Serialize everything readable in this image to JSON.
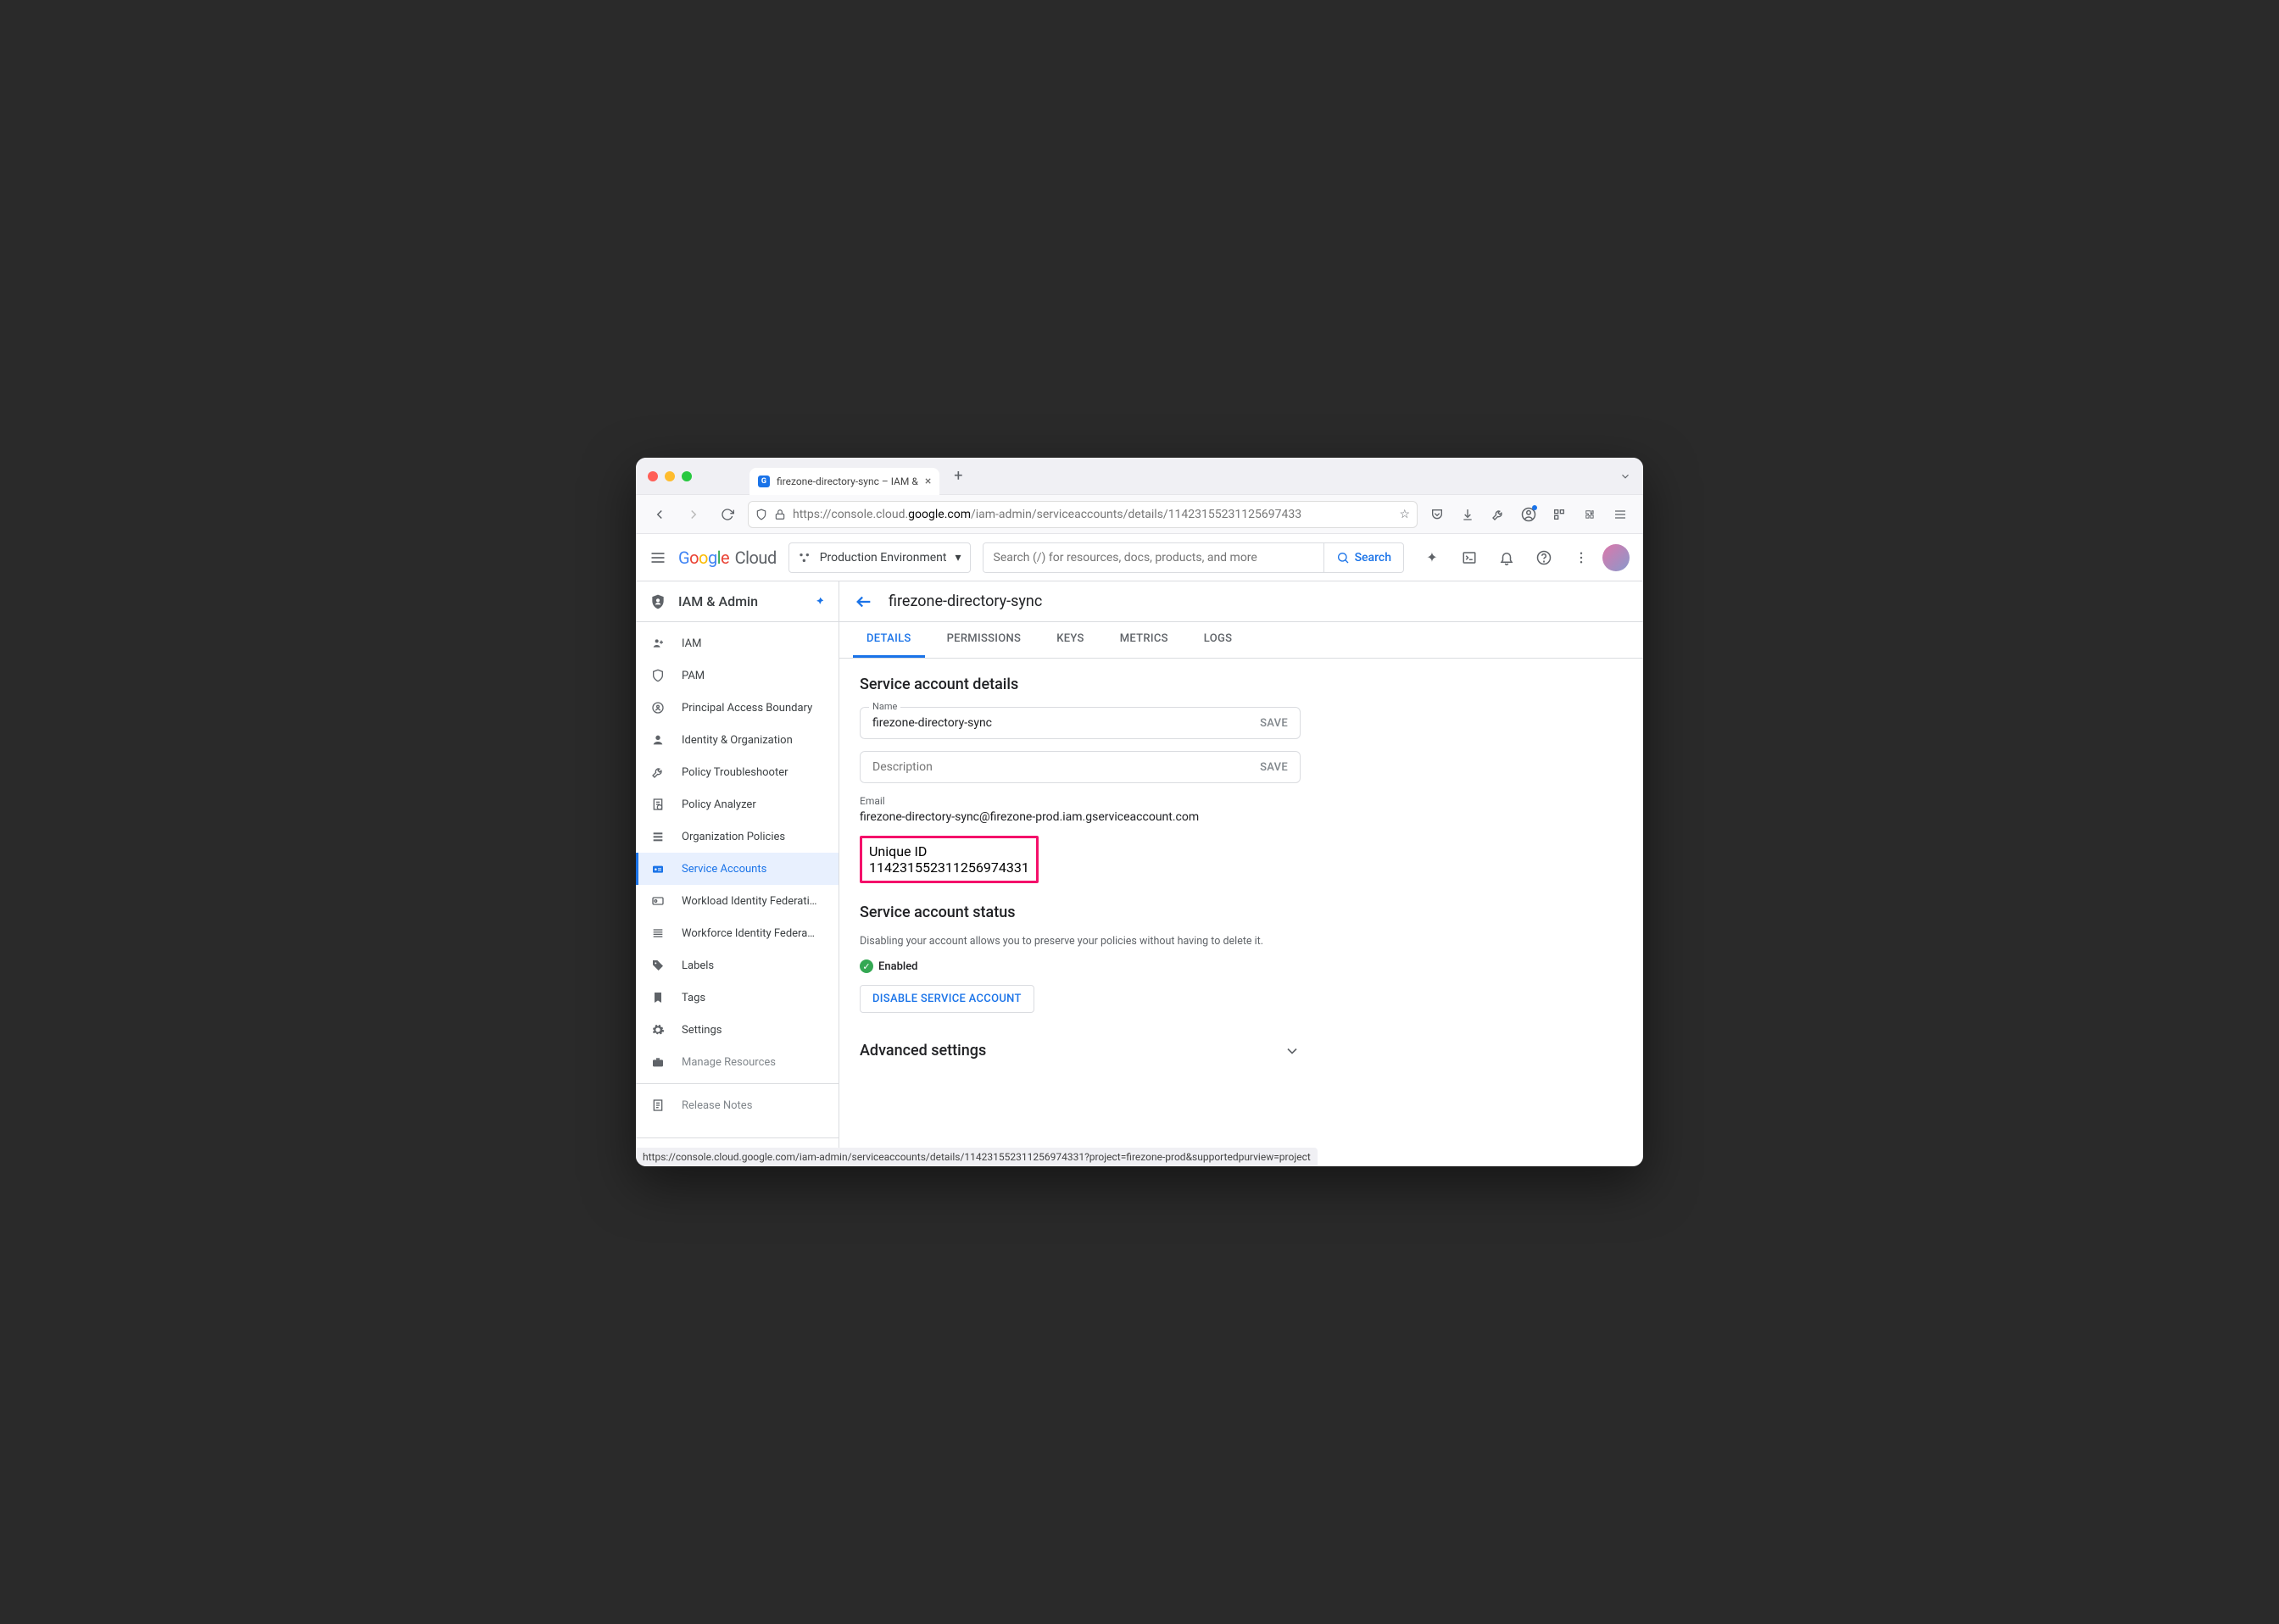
{
  "browser": {
    "tab_title": "firezone-directory-sync – IAM &",
    "url_prefix": "https://console.cloud.",
    "url_host_bold": "google.com",
    "url_path": "/iam-admin/serviceaccounts/details/11423155231125697433",
    "status_bar": "https://console.cloud.google.com/iam-admin/serviceaccounts/details/114231552311256974331?project=firezone-prod&supportedpurview=project"
  },
  "gcp": {
    "product_name": "Cloud",
    "project": "Production Environment",
    "search_placeholder": "Search (/) for resources, docs, products, and more",
    "search_button": "Search"
  },
  "sidebar": {
    "section_title": "IAM & Admin",
    "items": [
      {
        "label": "IAM"
      },
      {
        "label": "PAM"
      },
      {
        "label": "Principal Access Boundary"
      },
      {
        "label": "Identity & Organization"
      },
      {
        "label": "Policy Troubleshooter"
      },
      {
        "label": "Policy Analyzer"
      },
      {
        "label": "Organization Policies"
      },
      {
        "label": "Service Accounts"
      },
      {
        "label": "Workload Identity Federati…"
      },
      {
        "label": "Workforce Identity Federa…"
      },
      {
        "label": "Labels"
      },
      {
        "label": "Tags"
      },
      {
        "label": "Settings"
      },
      {
        "label": "Manage Resources"
      },
      {
        "label": "Release Notes"
      }
    ]
  },
  "main": {
    "title": "firezone-directory-sync",
    "tabs": [
      "DETAILS",
      "PERMISSIONS",
      "KEYS",
      "METRICS",
      "LOGS"
    ],
    "active_tab": 0,
    "details_heading": "Service account details",
    "name_label": "Name",
    "name_value": "firezone-directory-sync",
    "desc_placeholder": "Description",
    "save_label": "SAVE",
    "email_label": "Email",
    "email_value": "firezone-directory-sync@firezone-prod.iam.gserviceaccount.com",
    "uid_label": "Unique ID",
    "uid_value": "114231552311256974331",
    "status_heading": "Service account status",
    "status_desc": "Disabling your account allows you to preserve your policies without having to delete it.",
    "enabled_label": "Enabled",
    "disable_button": "DISABLE SERVICE ACCOUNT",
    "advanced_heading": "Advanced settings"
  }
}
